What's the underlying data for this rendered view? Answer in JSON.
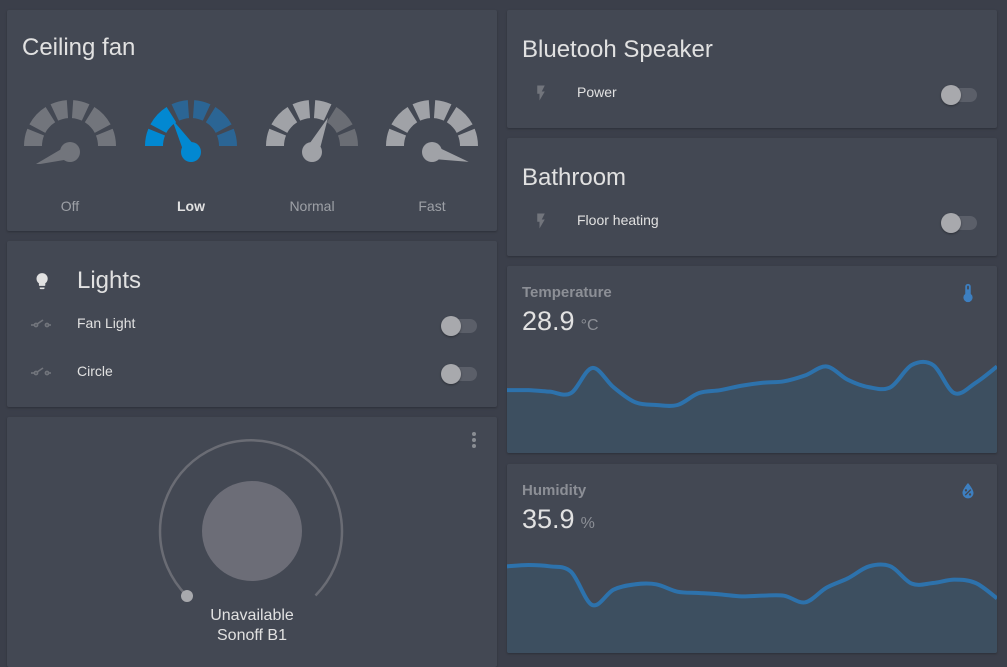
{
  "colors": {
    "accent": "#0288d1",
    "accent_dim": "#2b6594",
    "icon_inactive": "#72757c",
    "chart_line": "#2d72ac",
    "chart_fill": "#3d4f60"
  },
  "ceiling_fan": {
    "title": "Ceiling fan",
    "selected": "Low",
    "options": [
      {
        "label": "Off",
        "icon": "speedometer-off-icon",
        "active": false
      },
      {
        "label": "Low",
        "icon": "speedometer-slow-icon",
        "active": true
      },
      {
        "label": "Normal",
        "icon": "speedometer-medium-icon",
        "active": false
      },
      {
        "label": "Fast",
        "icon": "speedometer-fast-icon",
        "active": false
      }
    ]
  },
  "lights": {
    "title": "Lights",
    "header_icon": "lightbulb-icon",
    "entities": [
      {
        "label": "Fan Light",
        "icon": "light-switch-icon",
        "state": "off"
      },
      {
        "label": "Circle",
        "icon": "light-switch-icon",
        "state": "off"
      }
    ]
  },
  "bluetooth_speaker": {
    "title": "Bluetooh Speaker",
    "entities": [
      {
        "label": "Power",
        "icon": "flash-icon",
        "state": "off"
      }
    ]
  },
  "bathroom": {
    "title": "Bathroom",
    "entities": [
      {
        "label": "Floor heating",
        "icon": "flash-icon",
        "state": "off"
      }
    ]
  },
  "light_control": {
    "state": "Unavailable",
    "name": "Sonoff B1",
    "menu_icon": "dots-vertical-icon",
    "brightness_percent": 0
  },
  "temperature": {
    "name": "Temperature",
    "value": "28.9",
    "unit": "°C",
    "icon": "thermometer-icon"
  },
  "humidity": {
    "name": "Humidity",
    "value": "35.9",
    "unit": "%",
    "icon": "water-percent-icon"
  },
  "chart_data": [
    {
      "type": "area",
      "title": "Temperature",
      "note": "sparkline, no axes; relative values estimated",
      "series": [
        {
          "name": "Temperature",
          "values": [
            28.8,
            28.8,
            28.79,
            28.78,
            28.95,
            28.82,
            28.72,
            28.7,
            28.7,
            28.78,
            28.8,
            28.83,
            28.85,
            28.86,
            28.9,
            28.96,
            28.87,
            28.82,
            28.82,
            28.97,
            28.97,
            28.78,
            28.85,
            28.96
          ]
        }
      ]
    },
    {
      "type": "area",
      "title": "Humidity",
      "note": "sparkline, no axes; relative values estimated",
      "series": [
        {
          "name": "Humidity",
          "values": [
            36.3,
            36.32,
            36.3,
            36.22,
            35.72,
            35.95,
            36.03,
            36.03,
            35.92,
            35.9,
            35.88,
            35.85,
            35.86,
            35.86,
            35.76,
            35.98,
            36.12,
            36.3,
            36.3,
            36.04,
            36.05,
            36.1,
            36.05,
            35.82
          ]
        }
      ]
    }
  ]
}
